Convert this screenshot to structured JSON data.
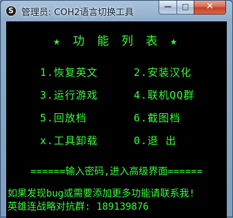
{
  "window": {
    "title": "管理员:  COH2语言切换工具",
    "app_icon_glyph": "S",
    "controls": {
      "minimize": "—",
      "maximize": "□",
      "close": "✕"
    }
  },
  "colors": {
    "console_bg": "#000000",
    "console_text": "#33ff33",
    "close_button": "#c7432a"
  },
  "console": {
    "menu_title": "★ 功 能 列 表 ★",
    "items_left": [
      "1.恢复英文",
      "3.运行游戏",
      "5.回放档",
      "x.工具卸载"
    ],
    "items_right": [
      "2.安装汉化",
      "4.联机QQ群",
      "6.截图档",
      "0.退 出"
    ],
    "password_prompt": "======输入密码,进入高级界面======",
    "note_line1": "如果发现bug或需要添加更多功能请联系我!",
    "note_line2": "英雄连战略对抗群: 189139876"
  }
}
